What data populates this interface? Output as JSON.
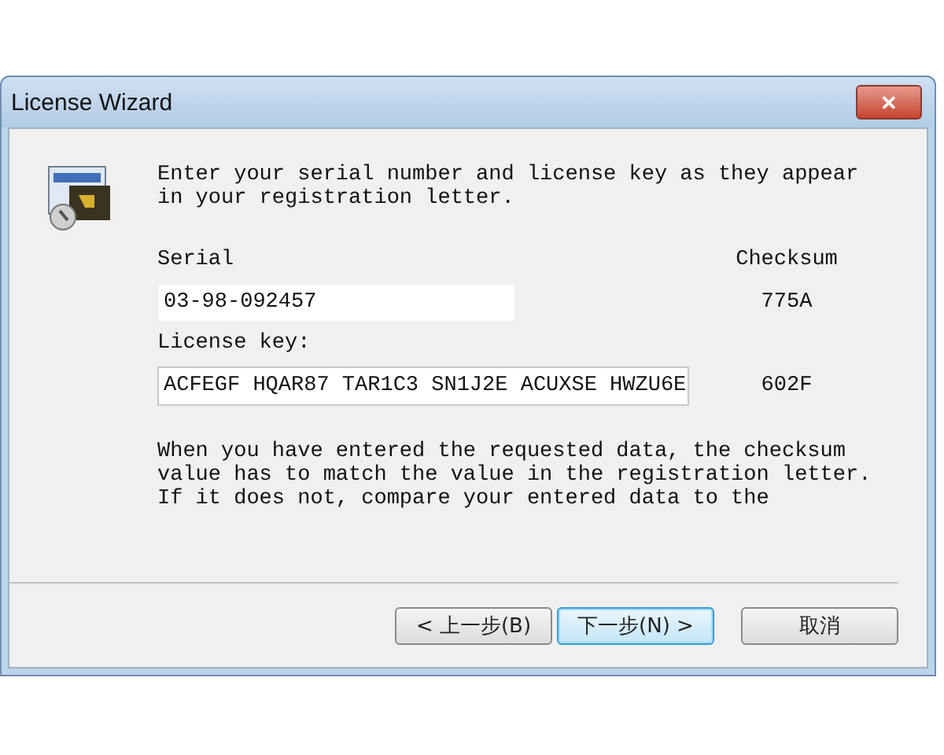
{
  "window": {
    "title": "License Wizard",
    "close": "✕"
  },
  "instructions": "Enter your serial number and license key as they appear\nin your registration letter.",
  "checksum_heading": "Checksum",
  "fields": [
    {
      "label": "Serial",
      "value": "03-98-092457",
      "checksum": "775A"
    },
    {
      "label": "License key:",
      "value": "ACFEGF HQAR87 TAR1C3 SN1J2E ACUXSE HWZU6E",
      "checksum": "602F"
    }
  ],
  "note": "When you have entered the requested data, the checksum\nvalue has to match the value in the registration letter.\nIf it does not, compare your entered data to the",
  "buttons": [
    {
      "label": "< 上一步(B)",
      "selected": false
    },
    {
      "label": "下一步(N) >",
      "selected": true
    },
    {
      "label": "取消",
      "selected": false
    }
  ]
}
